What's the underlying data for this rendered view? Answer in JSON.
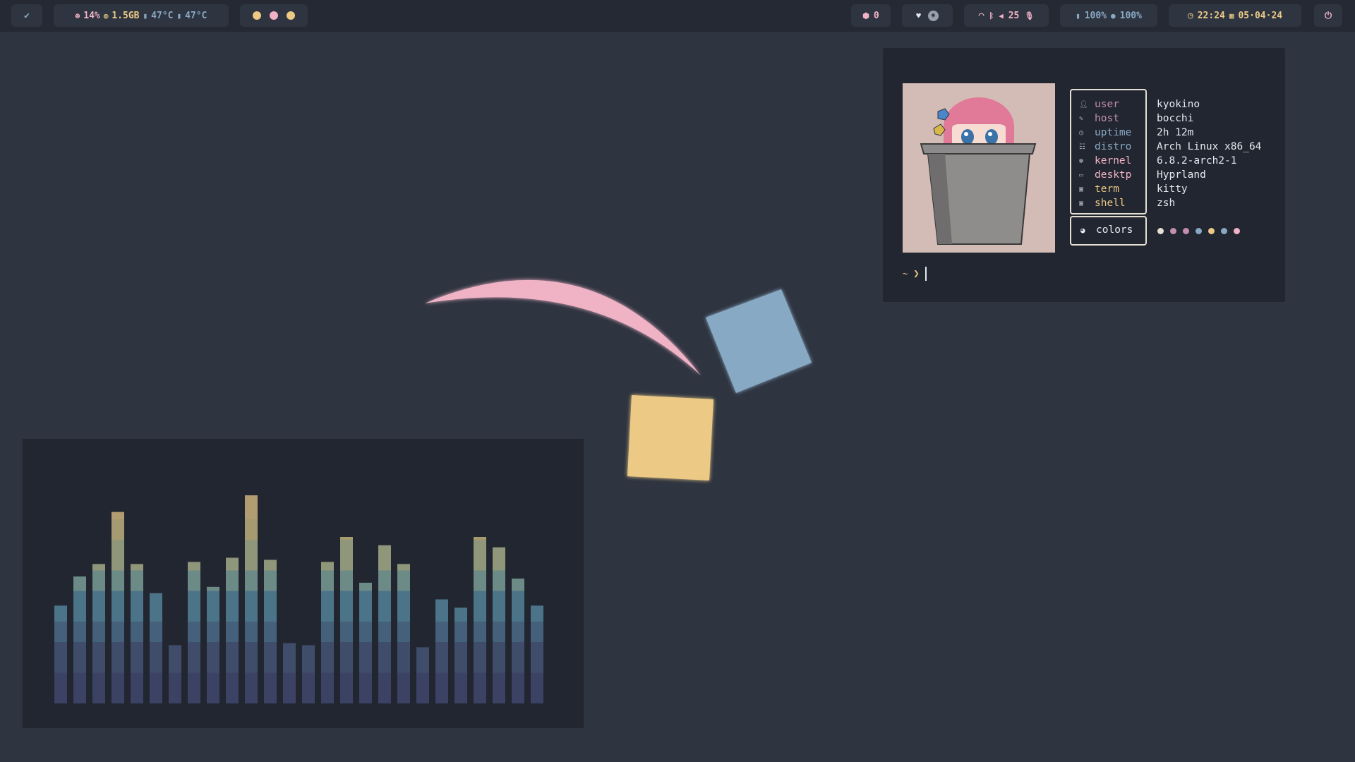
{
  "colors": {
    "bar_bg": "#242933",
    "pill_bg": "#2e3440",
    "desktop_bg": "#2e3440",
    "window_bg": "#222630",
    "pink": "#f0b3c6",
    "yellow": "#ecca86",
    "blue": "#88a9c4",
    "mauve": "#c48eb0",
    "text": "#e5e9f0",
    "label": "#a6a2b5"
  },
  "topbar": {
    "launcher_icon": "arch-check-icon",
    "stats": {
      "cpu_icon": "cpu-icon",
      "cpu": "14%",
      "mem_icon": "memory-icon",
      "mem": "1.5GB",
      "temp_icon": "thermometer-icon",
      "temp1": "47°C",
      "temp2": "47°C"
    },
    "workspaces": [
      "#ecca86",
      "#f0b3c6",
      "#ecca86"
    ],
    "updates": {
      "icon": "package-icon",
      "count": "0"
    },
    "tray": {
      "icon1": "heart-shield-icon",
      "icon2": "discord-icon"
    },
    "network": {
      "wifi_icon": "wifi-icon",
      "bt_icon": "bluetooth-icon",
      "volume_icon": "volume-icon",
      "volume": "25",
      "mic_icon": "mic-icon"
    },
    "battery": {
      "icon": "battery-icon",
      "value": "100%",
      "bright_icon": "brightness-icon",
      "bright": "100%"
    },
    "clock": {
      "clock_icon": "clock-icon",
      "time": "22:24",
      "cal_icon": "calendar-icon",
      "date": "05·04·24"
    },
    "power_icon": "power-icon"
  },
  "fetch": {
    "labels": [
      {
        "key": "user",
        "icon": "user-icon",
        "color": "#c48eb0"
      },
      {
        "key": "host",
        "icon": "pen-icon",
        "color": "#c48eb0"
      },
      {
        "key": "uptime",
        "icon": "clock-icon",
        "color": "#88a9c4"
      },
      {
        "key": "distro",
        "icon": "distro-icon",
        "color": "#88a9c4"
      },
      {
        "key": "kernel",
        "icon": "gear-icon",
        "color": "#f0b3c6"
      },
      {
        "key": "desktp",
        "icon": "monitor-icon",
        "color": "#f0b3c6"
      },
      {
        "key": "term",
        "icon": "terminal-icon",
        "color": "#ecca86"
      },
      {
        "key": "shell",
        "icon": "terminal-icon",
        "color": "#ecca86"
      }
    ],
    "values": [
      "kyokino",
      "bocchi",
      "2h 12m",
      "Arch Linux x86_64",
      "6.8.2-arch2-1",
      "Hyprland",
      "kitty",
      "zsh"
    ],
    "colors_label": "colors",
    "colors_icon": "palette-icon",
    "palette": [
      "#e5e0d3",
      "#c48eb0",
      "#c48eb0",
      "#88a9c4",
      "#ecca86",
      "#88a9c4",
      "#f0b3c6"
    ],
    "prompt_tilde": "~",
    "prompt_symbol": "❯"
  },
  "visualizer": {
    "levels": [
      0.47,
      0.61,
      0.67,
      0.92,
      0.67,
      0.53,
      0.28,
      0.68,
      0.56,
      0.7,
      1.0,
      0.69,
      0.29,
      0.28,
      0.68,
      0.8,
      0.58,
      0.76,
      0.67,
      0.27,
      0.5,
      0.46,
      0.8,
      0.75,
      0.6,
      0.47
    ],
    "gradient": [
      "#3b4263",
      "#3f4d6a",
      "#44607a",
      "#4c7488",
      "#6c8a86",
      "#8f967a",
      "#a59a70",
      "#b29c72",
      "#c48eb0"
    ]
  }
}
